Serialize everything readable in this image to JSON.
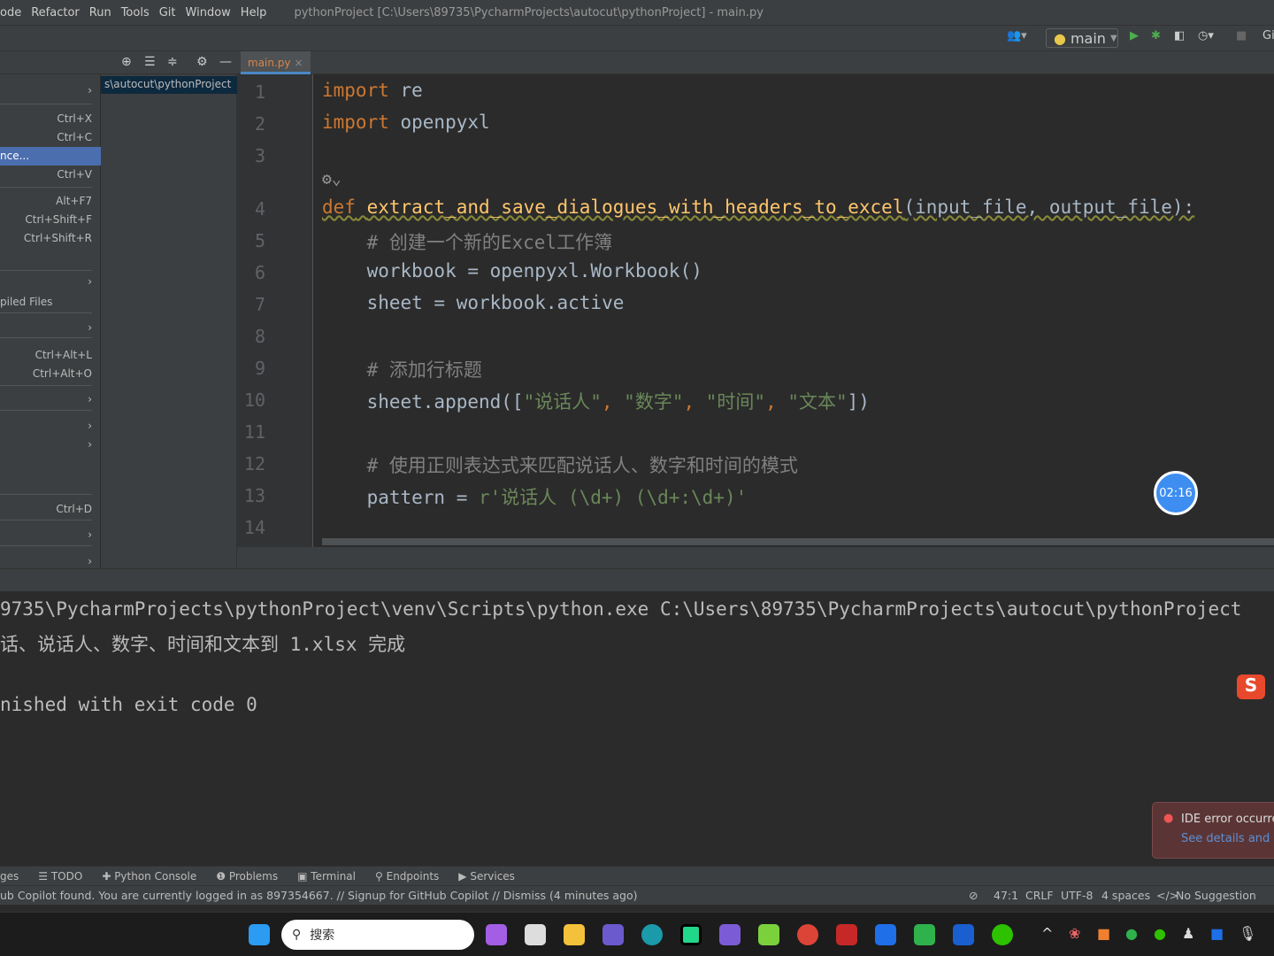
{
  "menubar": {
    "items": [
      "ode",
      "Refactor",
      "Run",
      "Tools",
      "Git",
      "Window",
      "Help"
    ],
    "title": "pythonProject [C:\\Users\\89735\\PycharmProjects\\autocut\\pythonProject] - main.py"
  },
  "toolbar": {
    "run_config": "main",
    "git_label": "Gi"
  },
  "editor": {
    "tab": "main.py",
    "tab_close": "×"
  },
  "project": {
    "path": "s\\autocut\\pythonProject"
  },
  "context_menu": [
    {
      "label": "",
      "shortcut": "›"
    },
    {
      "label": "",
      "shortcut": "Ctrl+X"
    },
    {
      "label": "",
      "shortcut": "Ctrl+C"
    },
    {
      "label": "nce...",
      "shortcut": "",
      "selected": true
    },
    {
      "label": "",
      "shortcut": "Ctrl+V"
    },
    {
      "label": "",
      "shortcut": "Alt+F7"
    },
    {
      "label": "",
      "shortcut": "Ctrl+Shift+F"
    },
    {
      "label": "",
      "shortcut": "Ctrl+Shift+R"
    },
    {
      "label": "",
      "shortcut": "›"
    },
    {
      "label": "piled Files",
      "shortcut": ""
    },
    {
      "label": "",
      "shortcut": "›"
    },
    {
      "label": "",
      "shortcut": "Ctrl+Alt+L"
    },
    {
      "label": "",
      "shortcut": "Ctrl+Alt+O"
    },
    {
      "label": "",
      "shortcut": "›"
    },
    {
      "label": "",
      "shortcut": "›"
    },
    {
      "label": "",
      "shortcut": "›"
    },
    {
      "label": "",
      "shortcut": "Ctrl+D"
    },
    {
      "label": "",
      "shortcut": "›"
    },
    {
      "label": "",
      "shortcut": "›"
    },
    {
      "label": "",
      "shortcut": "›"
    }
  ],
  "code": {
    "line_numbers": [
      "1",
      "2",
      "3",
      "4",
      "5",
      "6",
      "7",
      "8",
      "9",
      "10",
      "11",
      "12",
      "13",
      "14"
    ],
    "lines": {
      "l1": [
        "import",
        " re"
      ],
      "l2": [
        "import",
        " openpyxl"
      ],
      "l4": [
        "def",
        " ",
        "extract_and_save_dialogues_with_headers_to_excel",
        "(input_file, output_file):"
      ],
      "l5": "    # 创建一个新的Excel工作簿",
      "l6": "    workbook = openpyxl.Workbook()",
      "l7": "    sheet = workbook.active",
      "l9": "    # 添加行标题",
      "l10": [
        "    sheet.append([",
        "\"说话人\"",
        ", ",
        "\"数字\"",
        ", ",
        "\"时间\"",
        ", ",
        "\"文本\"",
        "])"
      ],
      "l12": "    # 使用正则表达式来匹配说话人、数字和时间的模式",
      "l13": [
        "    pattern = ",
        "r'说话人 (\\d+) (\\d+:\\d+)'"
      ]
    }
  },
  "console": [
    "9735\\PycharmProjects\\pythonProject\\venv\\Scripts\\python.exe C:\\Users\\89735\\PycharmProjects\\autocut\\pythonProject",
    "话、说话人、数字、时间和文本到 1.xlsx 完成",
    "",
    "nished with exit code 0"
  ],
  "timer": "02:16",
  "toast": {
    "title": "IDE error occurred",
    "link": "See details and su"
  },
  "tool_windows": [
    "ges",
    "TODO",
    "Python Console",
    "Problems",
    "Terminal",
    "Endpoints",
    "Services"
  ],
  "status": {
    "message": "ub Copilot found. You are currently logged in as 897354667. // Signup for GitHub Copilot // Dismiss (4 minutes ago)",
    "position": "47:1",
    "line_sep": "CRLF",
    "encoding": "UTF-8",
    "indent": "4 spaces",
    "copilot": "No Suggestion"
  },
  "taskbar": {
    "search_placeholder": "搜索"
  },
  "colors": {
    "keyword": "#cc7832",
    "function": "#ffc66d",
    "comment": "#808080",
    "string": "#6a8759",
    "selection": "#4b6eaf"
  }
}
